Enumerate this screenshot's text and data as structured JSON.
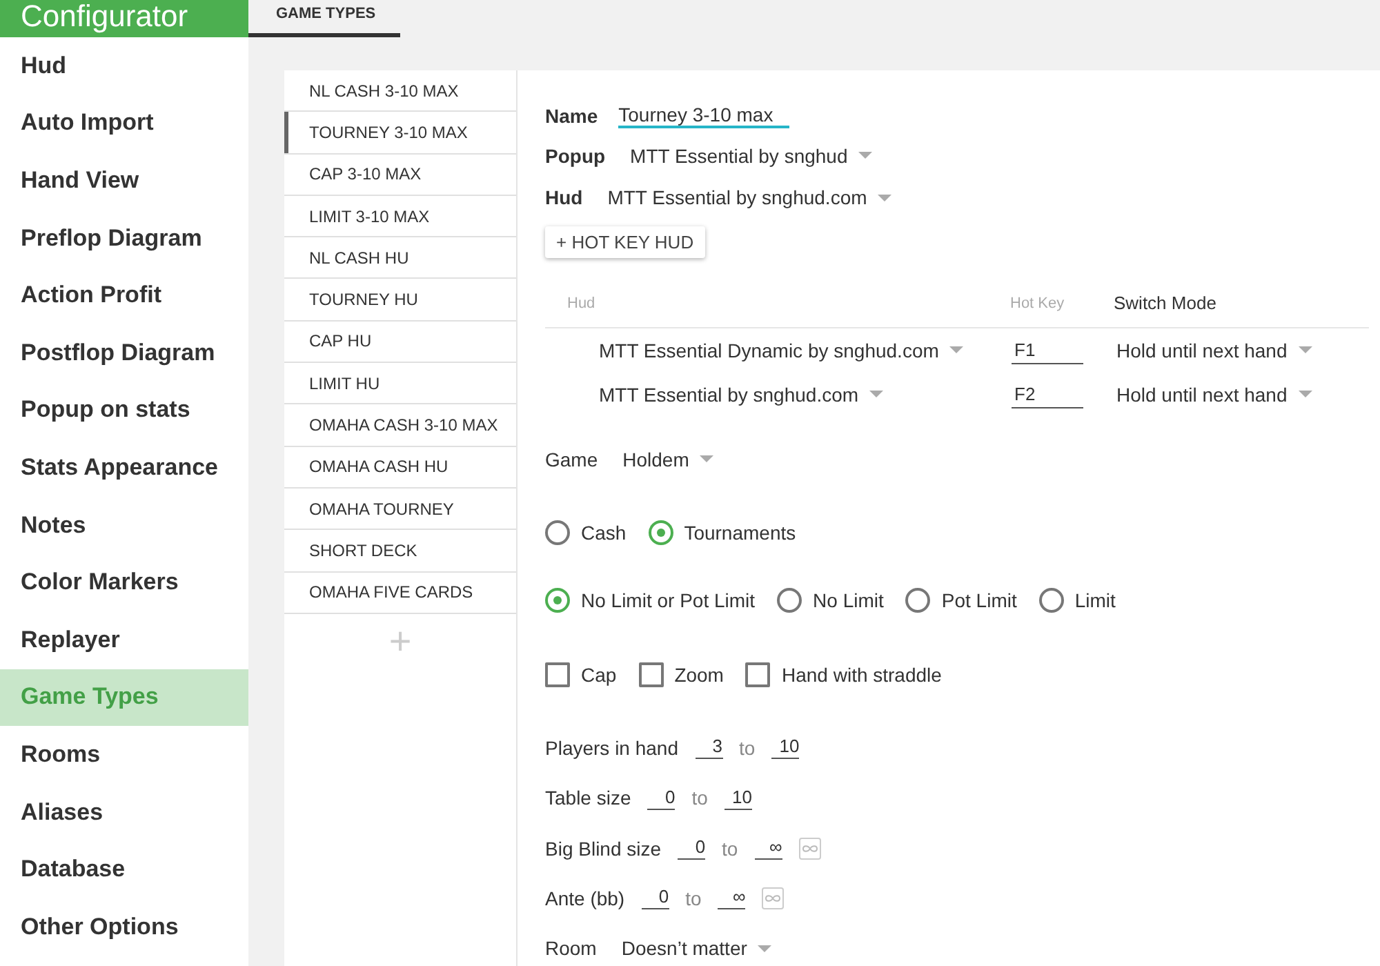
{
  "sidebar": {
    "title": "Configurator",
    "items": [
      {
        "label": "Hud",
        "selected": false
      },
      {
        "label": "Auto Import",
        "selected": false
      },
      {
        "label": "Hand View",
        "selected": false
      },
      {
        "label": "Preflop Diagram",
        "selected": false
      },
      {
        "label": "Action Profit",
        "selected": false
      },
      {
        "label": "Postflop Diagram",
        "selected": false
      },
      {
        "label": "Popup on stats",
        "selected": false
      },
      {
        "label": "Stats Appearance",
        "selected": false
      },
      {
        "label": "Notes",
        "selected": false
      },
      {
        "label": "Color Markers",
        "selected": false
      },
      {
        "label": "Replayer",
        "selected": false
      },
      {
        "label": "Game Types",
        "selected": true
      },
      {
        "label": "Rooms",
        "selected": false
      },
      {
        "label": "Aliases",
        "selected": false
      },
      {
        "label": "Database",
        "selected": false
      },
      {
        "label": "Other Options",
        "selected": false
      }
    ]
  },
  "tabs": [
    {
      "label": "GAME TYPES",
      "selected": true
    }
  ],
  "game_types": {
    "items": [
      {
        "label": "NL CASH 3-10 MAX",
        "selected": false
      },
      {
        "label": "TOURNEY 3-10 MAX",
        "selected": true
      },
      {
        "label": "CAP 3-10 MAX",
        "selected": false
      },
      {
        "label": "LIMIT 3-10 MAX",
        "selected": false
      },
      {
        "label": "NL CASH HU",
        "selected": false
      },
      {
        "label": "TOURNEY HU",
        "selected": false
      },
      {
        "label": "CAP HU",
        "selected": false
      },
      {
        "label": "LIMIT HU",
        "selected": false
      },
      {
        "label": "OMAHA CASH 3-10 MAX",
        "selected": false
      },
      {
        "label": "OMAHA CASH HU",
        "selected": false
      },
      {
        "label": "OMAHA TOURNEY",
        "selected": false
      },
      {
        "label": "SHORT DECK",
        "selected": false
      },
      {
        "label": "OMAHA FIVE CARDS",
        "selected": false
      }
    ],
    "add_button": "+"
  },
  "form": {
    "name": {
      "label": "Name",
      "value": "Tourney 3-10 max"
    },
    "popup": {
      "label": "Popup",
      "value": "MTT Essential by snghud"
    },
    "hud": {
      "label": "Hud",
      "value": "MTT Essential by snghud.com"
    },
    "hotkey_button": "+ HOT KEY HUD",
    "hotkey_table": {
      "columns": [
        "Hud",
        "Hot Key",
        "Switch Mode"
      ],
      "rows": [
        {
          "hud": "MTT Essential Dynamic by snghud.com",
          "hot_key": "F1",
          "switch_mode": "Hold until next hand"
        },
        {
          "hud": "MTT Essential by snghud.com",
          "hot_key": "F2",
          "switch_mode": "Hold until next hand"
        }
      ]
    },
    "game": {
      "label": "Game",
      "value": "Holdem"
    },
    "session_type": [
      {
        "label": "Cash",
        "selected": false
      },
      {
        "label": "Tournaments",
        "selected": true
      }
    ],
    "limit_type": [
      {
        "label": "No Limit or Pot Limit",
        "selected": true
      },
      {
        "label": "No Limit",
        "selected": false
      },
      {
        "label": "Pot Limit",
        "selected": false
      },
      {
        "label": "Limit",
        "selected": false
      }
    ],
    "options": [
      {
        "label": "Cap",
        "checked": false
      },
      {
        "label": "Zoom",
        "checked": false
      },
      {
        "label": "Hand with straddle",
        "checked": false
      }
    ],
    "ranges": [
      {
        "label": "Players in hand",
        "from": "3",
        "separator": "to",
        "to": "10",
        "infinity_toggle": false
      },
      {
        "label": "Table size",
        "from": "0",
        "separator": "to",
        "to": "10",
        "infinity_toggle": false
      },
      {
        "label": "Big Blind size",
        "from": "0",
        "separator": "to",
        "to": "∞",
        "infinity_toggle": true
      },
      {
        "label": "Ante (bb)",
        "from": "0",
        "separator": "to",
        "to": "∞",
        "infinity_toggle": true
      }
    ],
    "room": {
      "label": "Room",
      "value": "Doesn’t matter"
    }
  }
}
